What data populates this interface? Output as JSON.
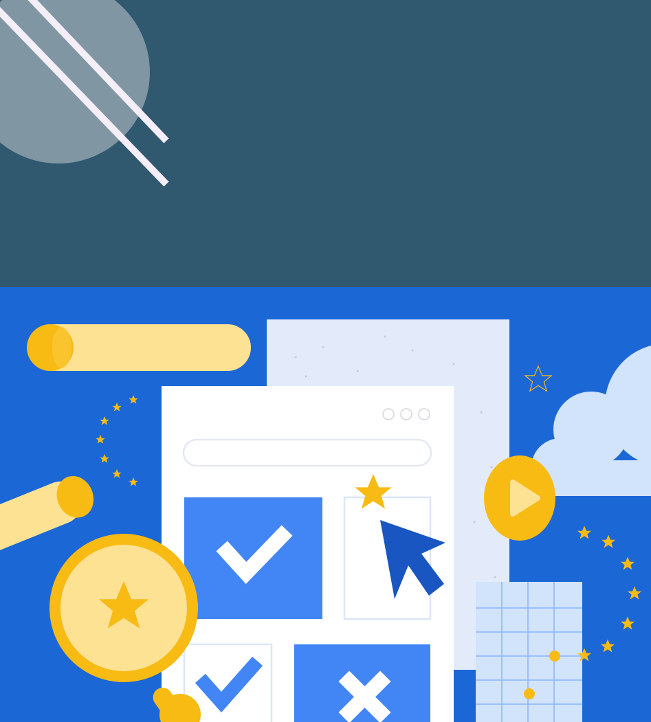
{
  "colors": {
    "header_bg": "#30586f",
    "circle": "#8096a3",
    "lines": "#f4eef8",
    "illustration_bg": "#1c67d6",
    "yellow": "#f8bb14",
    "light_yellow": "#fde293",
    "white": "#ffffff",
    "light_blue": "#e3ebfb",
    "cloud": "#d2e3fc",
    "blue": "#4285f4",
    "cursor": "#1a56c1"
  },
  "icons": [
    "check-icon",
    "close-icon",
    "star-icon",
    "cursor-icon",
    "play-icon",
    "magnifier-icon",
    "cloud-icon"
  ]
}
